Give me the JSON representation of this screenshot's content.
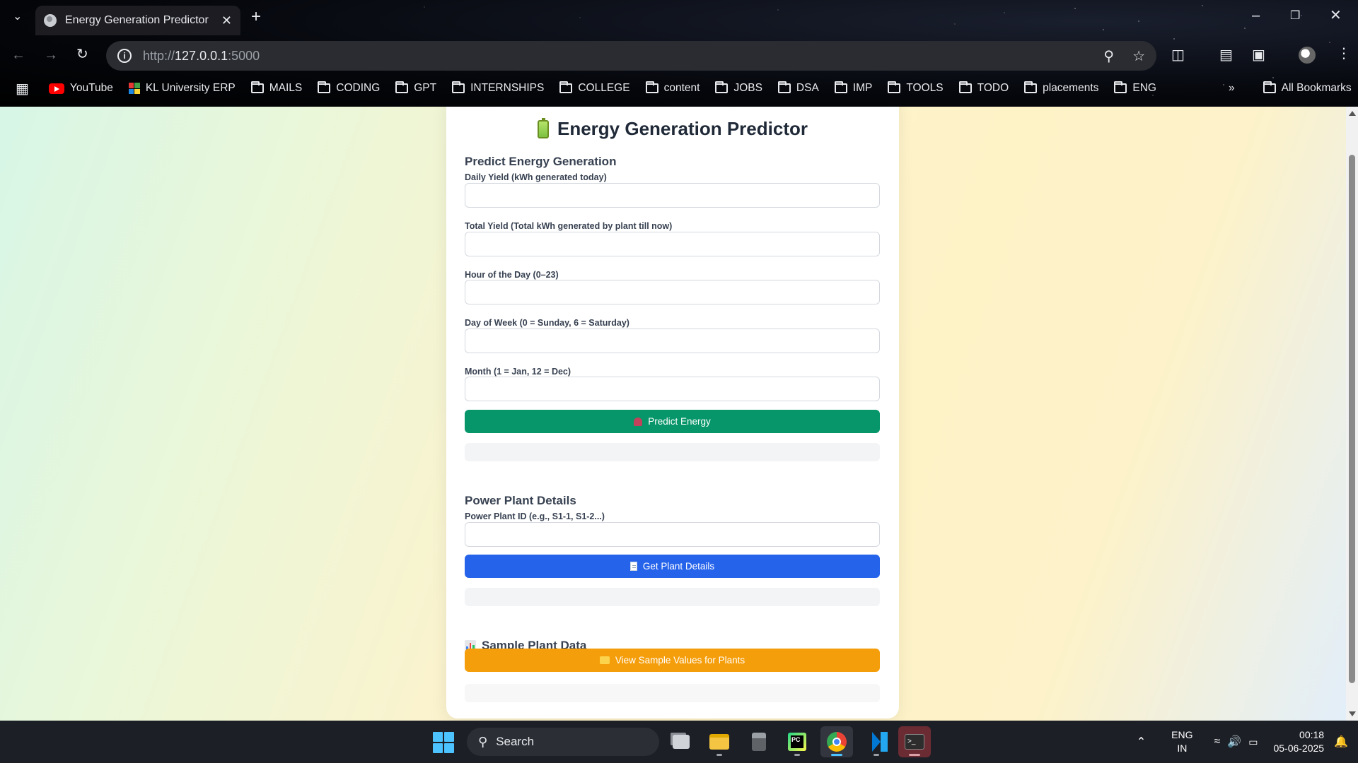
{
  "browser": {
    "tab_title": "Energy Generation Predictor",
    "url_prefix": "http://",
    "url_host": "127.0.0.1",
    "url_port": ":5000",
    "bookmarks": [
      {
        "label": "YouTube",
        "icon": "youtube-icon"
      },
      {
        "label": "KL University ERP",
        "icon": "kl-erp-icon"
      },
      {
        "label": "MAILS",
        "icon": "folder-icon"
      },
      {
        "label": "CODING",
        "icon": "folder-icon"
      },
      {
        "label": "GPT",
        "icon": "folder-icon"
      },
      {
        "label": "INTERNSHIPS",
        "icon": "folder-icon"
      },
      {
        "label": "COLLEGE",
        "icon": "folder-icon"
      },
      {
        "label": "content",
        "icon": "folder-icon"
      },
      {
        "label": "JOBS",
        "icon": "folder-icon"
      },
      {
        "label": "DSA",
        "icon": "folder-icon"
      },
      {
        "label": "IMP",
        "icon": "folder-icon"
      },
      {
        "label": "TOOLS",
        "icon": "folder-icon"
      },
      {
        "label": "TODO",
        "icon": "folder-icon"
      },
      {
        "label": "placements",
        "icon": "folder-icon"
      },
      {
        "label": "ENG",
        "icon": "folder-icon"
      }
    ],
    "all_bookmarks": "All Bookmarks"
  },
  "page": {
    "title": "Energy Generation Predictor",
    "predict_section": {
      "heading": "Predict Energy Generation",
      "fields": [
        {
          "label": "Daily Yield (kWh generated today)",
          "value": "",
          "placeholder": ""
        },
        {
          "label": "Total Yield (Total kWh generated by plant till now)",
          "value": "",
          "placeholder": ""
        },
        {
          "label": "Hour of the Day (0–23)",
          "value": "",
          "placeholder": ""
        },
        {
          "label": "Day of Week (0 = Sunday, 6 = Saturday)",
          "value": "",
          "placeholder": ""
        },
        {
          "label": "Month (1 = Jan, 12 = Dec)",
          "value": "",
          "placeholder": ""
        }
      ],
      "button": "Predict Energy",
      "result": ""
    },
    "plant_section": {
      "heading": "Power Plant Details",
      "field_label": "Power Plant ID (e.g., S1-1, S1-2...)",
      "field_value": "",
      "button": "Get Plant Details",
      "result": ""
    },
    "sample_section": {
      "heading": "Sample Plant Data",
      "button": "View Sample Values for Plants",
      "result": ""
    }
  },
  "taskbar": {
    "search_label": "Search",
    "lang_line1": "ENG",
    "lang_line2": "IN",
    "time": "00:18",
    "date": "05-06-2025"
  },
  "colors": {
    "predict_button": "#079669",
    "plant_button": "#2563eb",
    "sample_button": "#f59e0b"
  }
}
